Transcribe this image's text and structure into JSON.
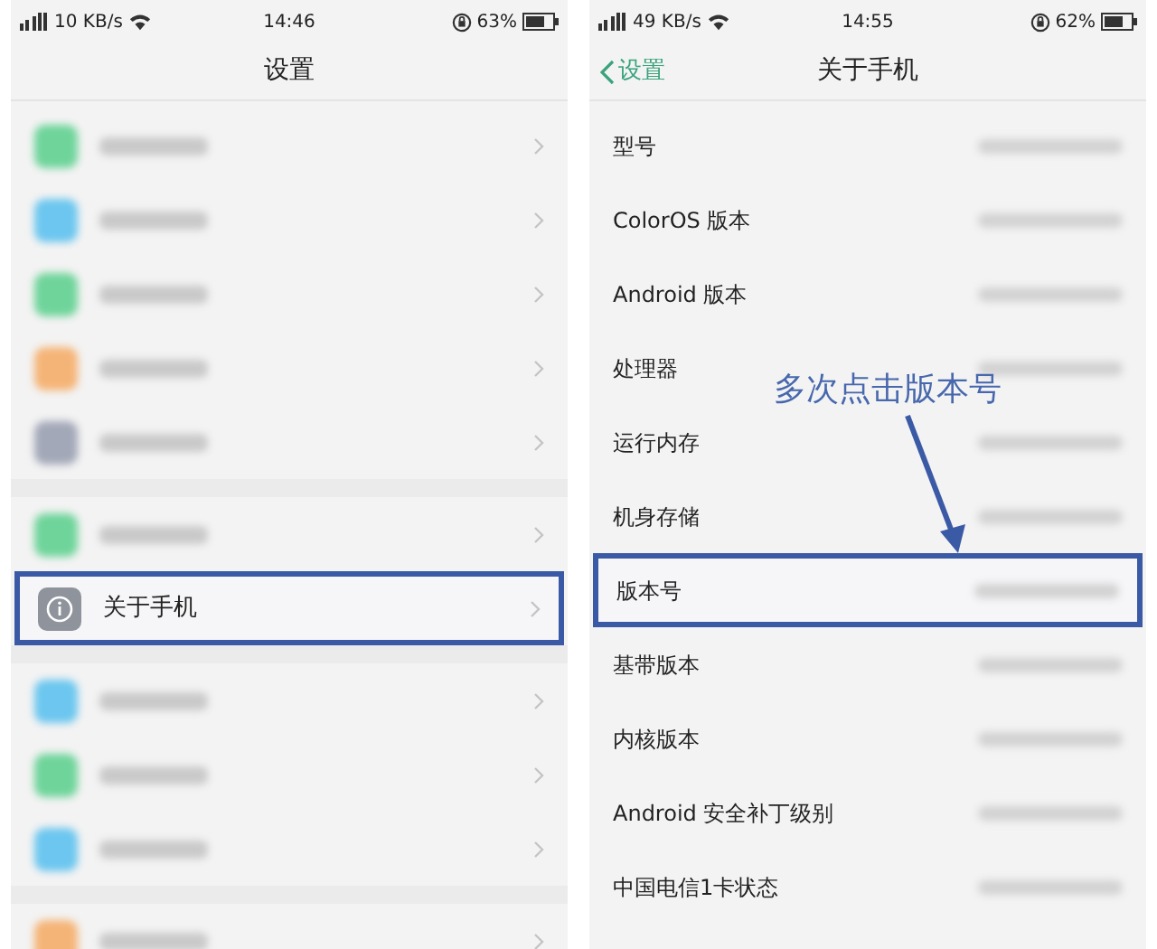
{
  "screens": [
    {
      "status_bar": {
        "speed": "10 KB/s",
        "time": "14:46",
        "battery": "63%"
      },
      "title": "设置",
      "groups": [
        [
          {
            "kind": "blurred",
            "color": "#6fd49a",
            "highlighted": false
          },
          {
            "kind": "blurred",
            "color": "#6cc6ef",
            "highlighted": false
          },
          {
            "kind": "blurred",
            "color": "#6fd49a",
            "highlighted": false
          },
          {
            "kind": "blurred",
            "color": "#f5b477",
            "highlighted": false
          },
          {
            "kind": "blurred",
            "color": "#a3a8b8",
            "highlighted": false
          }
        ],
        [
          {
            "kind": "blurred",
            "color": "#6fd49a",
            "highlighted": false
          },
          {
            "kind": "about",
            "label": "关于手机",
            "highlighted": true
          }
        ],
        [
          {
            "kind": "blurred",
            "color": "#6cc6ef",
            "highlighted": false
          },
          {
            "kind": "blurred",
            "color": "#6fd49a",
            "highlighted": false
          },
          {
            "kind": "blurred",
            "color": "#6cc6ef",
            "highlighted": false
          }
        ],
        [
          {
            "kind": "blurred",
            "color": "#f5b477",
            "highlighted": false
          }
        ]
      ]
    },
    {
      "status_bar": {
        "speed": "49 KB/s",
        "time": "14:55",
        "battery": "62%"
      },
      "back": "设置",
      "title": "关于手机",
      "groups": [
        [
          {
            "kind": "info",
            "label": "型号",
            "highlighted": false
          },
          {
            "kind": "info",
            "label": "ColorOS 版本",
            "highlighted": false
          },
          {
            "kind": "info",
            "label": "Android 版本",
            "highlighted": false
          },
          {
            "kind": "info",
            "label": "处理器",
            "highlighted": false
          },
          {
            "kind": "info",
            "label": "运行内存",
            "highlighted": false
          },
          {
            "kind": "info",
            "label": "机身存储",
            "highlighted": false
          },
          {
            "kind": "info",
            "label": "版本号",
            "highlighted": true
          },
          {
            "kind": "info",
            "label": "基带版本",
            "highlighted": false
          },
          {
            "kind": "info",
            "label": "内核版本",
            "highlighted": false
          },
          {
            "kind": "info",
            "label": "Android 安全补丁级别",
            "highlighted": false
          },
          {
            "kind": "info",
            "label": "中国电信1卡状态",
            "highlighted": false
          }
        ]
      ],
      "annotation": {
        "text": "多次点击版本号"
      }
    }
  ]
}
